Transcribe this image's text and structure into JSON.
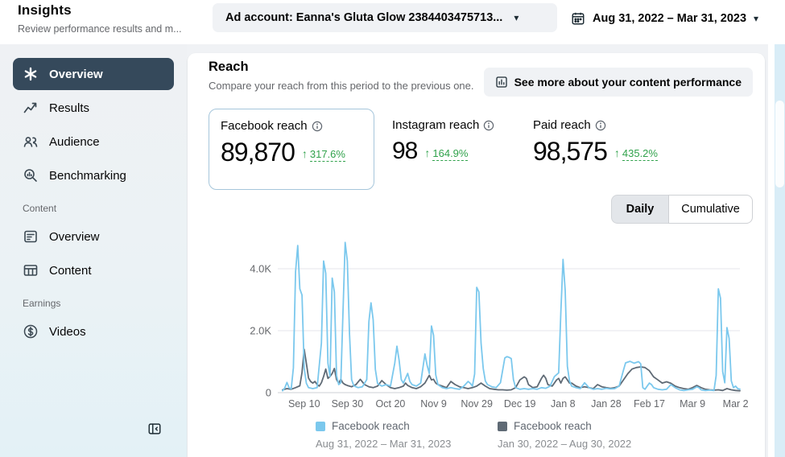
{
  "colors": {
    "positive_green": "#31a24c",
    "nav_active_bg": "#35495b",
    "selected_card_border": "#a6c6db",
    "current_line": "#7bc8ed",
    "previous_line": "#5f6a75"
  },
  "icons": {
    "caret_down": "▾",
    "up_arrow": "↑"
  },
  "header": {
    "title": "Insights",
    "subtitle": "Review performance results and m...",
    "ad_account_label": "Ad account: Eanna's Gluta Glow 2384403475713...",
    "date_range_label": "Aug 31, 2022 – Mar 31, 2023"
  },
  "sidebar": {
    "items": [
      {
        "label": "Overview",
        "active": true
      },
      {
        "label": "Results"
      },
      {
        "label": "Audience"
      },
      {
        "label": "Benchmarking"
      },
      {
        "label": "Overview"
      },
      {
        "label": "Content"
      },
      {
        "label": "Videos"
      }
    ],
    "section_labels": [
      {
        "label": "Content"
      },
      {
        "label": "Earnings"
      }
    ]
  },
  "main": {
    "section_title": "Reach",
    "section_subtitle": "Compare your reach from this period to the previous one.",
    "see_more_button": "See more about your content performance",
    "metrics": [
      {
        "label": "Facebook reach",
        "value": "89,870",
        "delta": "317.6%"
      },
      {
        "label": "Instagram reach",
        "value": "98",
        "delta": "164.9%"
      },
      {
        "label": "Paid reach",
        "value": "98,575",
        "delta": "435.2%"
      }
    ],
    "toggle": {
      "daily": "Daily",
      "cumulative": "Cumulative",
      "selected": "Daily"
    },
    "legend": [
      {
        "label": "Facebook reach",
        "period": "Aug 31, 2022 – Mar 31, 2023"
      },
      {
        "label": "Facebook reach",
        "period": "Jan 30, 2022 – Aug 30, 2022"
      }
    ]
  },
  "chart_data": {
    "type": "line",
    "x_unit": "days since Aug 31, 2022",
    "xlim": [
      0,
      212
    ],
    "ylim": [
      0,
      5000
    ],
    "grid": true,
    "y_ticks": [
      {
        "value": 0,
        "label": "0"
      },
      {
        "value": 2000,
        "label": "2.0K"
      },
      {
        "value": 4000,
        "label": "4.0K"
      }
    ],
    "x_ticks": [
      {
        "day": 10,
        "label": "Sep 10"
      },
      {
        "day": 30,
        "label": "Sep 30"
      },
      {
        "day": 50,
        "label": "Oct 20"
      },
      {
        "day": 70,
        "label": "Nov 9"
      },
      {
        "day": 90,
        "label": "Nov 29"
      },
      {
        "day": 110,
        "label": "Dec 19"
      },
      {
        "day": 130,
        "label": "Jan 8"
      },
      {
        "day": 150,
        "label": "Jan 28"
      },
      {
        "day": 170,
        "label": "Feb 17"
      },
      {
        "day": 190,
        "label": "Mar 9"
      },
      {
        "day": 210,
        "label": "Mar 2"
      }
    ],
    "series": [
      {
        "name": "Facebook reach (Aug 31, 2022 – Mar 31, 2023)",
        "color": "#7bc8ed",
        "points": [
          [
            0,
            60
          ],
          [
            1,
            150
          ],
          [
            2,
            330
          ],
          [
            3,
            160
          ],
          [
            4,
            120
          ],
          [
            5,
            800
          ],
          [
            6,
            3900
          ],
          [
            7,
            4750
          ],
          [
            8,
            3350
          ],
          [
            9,
            3150
          ],
          [
            10,
            800
          ],
          [
            11,
            300
          ],
          [
            12,
            160
          ],
          [
            14,
            130
          ],
          [
            16,
            160
          ],
          [
            18,
            1600
          ],
          [
            19,
            4250
          ],
          [
            20,
            3850
          ],
          [
            21,
            950
          ],
          [
            22,
            520
          ],
          [
            23,
            3700
          ],
          [
            24,
            3250
          ],
          [
            25,
            550
          ],
          [
            26,
            260
          ],
          [
            27,
            320
          ],
          [
            28,
            2600
          ],
          [
            29,
            4850
          ],
          [
            30,
            4250
          ],
          [
            31,
            1900
          ],
          [
            32,
            420
          ],
          [
            33,
            220
          ],
          [
            35,
            160
          ],
          [
            37,
            190
          ],
          [
            39,
            420
          ],
          [
            40,
            2300
          ],
          [
            41,
            2900
          ],
          [
            42,
            2350
          ],
          [
            43,
            750
          ],
          [
            44,
            300
          ],
          [
            46,
            210
          ],
          [
            48,
            260
          ],
          [
            50,
            210
          ],
          [
            52,
            950
          ],
          [
            53,
            1500
          ],
          [
            54,
            1050
          ],
          [
            55,
            420
          ],
          [
            56,
            310
          ],
          [
            58,
            620
          ],
          [
            59,
            360
          ],
          [
            60,
            260
          ],
          [
            62,
            210
          ],
          [
            64,
            310
          ],
          [
            66,
            1250
          ],
          [
            67,
            880
          ],
          [
            68,
            620
          ],
          [
            69,
            2150
          ],
          [
            70,
            1850
          ],
          [
            71,
            580
          ],
          [
            72,
            260
          ],
          [
            74,
            160
          ],
          [
            76,
            130
          ],
          [
            78,
            160
          ],
          [
            80,
            130
          ],
          [
            82,
            110
          ],
          [
            84,
            210
          ],
          [
            86,
            360
          ],
          [
            87,
            300
          ],
          [
            88,
            210
          ],
          [
            89,
            600
          ],
          [
            90,
            3400
          ],
          [
            91,
            3250
          ],
          [
            92,
            1600
          ],
          [
            93,
            780
          ],
          [
            94,
            380
          ],
          [
            95,
            260
          ],
          [
            97,
            190
          ],
          [
            99,
            160
          ],
          [
            101,
            320
          ],
          [
            103,
            1120
          ],
          [
            104,
            1160
          ],
          [
            105,
            1140
          ],
          [
            106,
            1100
          ],
          [
            107,
            420
          ],
          [
            108,
            160
          ],
          [
            110,
            110
          ],
          [
            112,
            130
          ],
          [
            114,
            110
          ],
          [
            116,
            130
          ],
          [
            118,
            110
          ],
          [
            120,
            160
          ],
          [
            122,
            140
          ],
          [
            124,
            210
          ],
          [
            126,
            520
          ],
          [
            128,
            640
          ],
          [
            129,
            2600
          ],
          [
            130,
            4300
          ],
          [
            131,
            3300
          ],
          [
            132,
            850
          ],
          [
            133,
            380
          ],
          [
            134,
            210
          ],
          [
            136,
            160
          ],
          [
            138,
            130
          ],
          [
            140,
            320
          ],
          [
            142,
            160
          ],
          [
            144,
            110
          ],
          [
            146,
            130
          ],
          [
            148,
            110
          ],
          [
            150,
            140
          ],
          [
            152,
            120
          ],
          [
            154,
            130
          ],
          [
            156,
            210
          ],
          [
            158,
            720
          ],
          [
            159,
            960
          ],
          [
            161,
            1010
          ],
          [
            163,
            950
          ],
          [
            165,
            1000
          ],
          [
            166,
            930
          ],
          [
            167,
            160
          ],
          [
            168,
            110
          ],
          [
            170,
            310
          ],
          [
            171,
            260
          ],
          [
            172,
            160
          ],
          [
            174,
            110
          ],
          [
            176,
            90
          ],
          [
            178,
            110
          ],
          [
            180,
            260
          ],
          [
            182,
            160
          ],
          [
            184,
            90
          ],
          [
            186,
            70
          ],
          [
            188,
            90
          ],
          [
            190,
            110
          ],
          [
            192,
            190
          ],
          [
            193,
            160
          ],
          [
            194,
            90
          ],
          [
            196,
            70
          ],
          [
            198,
            80
          ],
          [
            200,
            70
          ],
          [
            201,
            550
          ],
          [
            202,
            3350
          ],
          [
            203,
            3050
          ],
          [
            204,
            680
          ],
          [
            205,
            320
          ],
          [
            206,
            2100
          ],
          [
            207,
            1750
          ],
          [
            208,
            380
          ],
          [
            209,
            160
          ],
          [
            210,
            210
          ],
          [
            211,
            130
          ],
          [
            212,
            110
          ]
        ]
      },
      {
        "name": "Facebook reach (Jan 30, 2022 – Aug 30, 2022)",
        "color": "#5f6a75",
        "points": [
          [
            0,
            90
          ],
          [
            2,
            130
          ],
          [
            4,
            110
          ],
          [
            6,
            160
          ],
          [
            8,
            220
          ],
          [
            9,
            650
          ],
          [
            10,
            1400
          ],
          [
            11,
            950
          ],
          [
            12,
            470
          ],
          [
            13,
            360
          ],
          [
            14,
            310
          ],
          [
            15,
            360
          ],
          [
            16,
            260
          ],
          [
            17,
            210
          ],
          [
            18,
            320
          ],
          [
            19,
            520
          ],
          [
            20,
            760
          ],
          [
            21,
            460
          ],
          [
            22,
            520
          ],
          [
            23,
            620
          ],
          [
            24,
            780
          ],
          [
            25,
            420
          ],
          [
            26,
            310
          ],
          [
            27,
            430
          ],
          [
            28,
            310
          ],
          [
            29,
            260
          ],
          [
            30,
            230
          ],
          [
            32,
            190
          ],
          [
            34,
            260
          ],
          [
            36,
            430
          ],
          [
            38,
            260
          ],
          [
            40,
            190
          ],
          [
            42,
            160
          ],
          [
            44,
            210
          ],
          [
            46,
            390
          ],
          [
            48,
            260
          ],
          [
            50,
            160
          ],
          [
            52,
            130
          ],
          [
            54,
            160
          ],
          [
            56,
            210
          ],
          [
            57,
            310
          ],
          [
            58,
            230
          ],
          [
            60,
            160
          ],
          [
            62,
            130
          ],
          [
            64,
            190
          ],
          [
            66,
            310
          ],
          [
            68,
            560
          ],
          [
            69,
            410
          ],
          [
            70,
            430
          ],
          [
            71,
            310
          ],
          [
            72,
            260
          ],
          [
            74,
            210
          ],
          [
            76,
            160
          ],
          [
            78,
            360
          ],
          [
            80,
            260
          ],
          [
            82,
            190
          ],
          [
            84,
            160
          ],
          [
            86,
            130
          ],
          [
            88,
            160
          ],
          [
            90,
            210
          ],
          [
            92,
            310
          ],
          [
            94,
            210
          ],
          [
            96,
            130
          ],
          [
            98,
            110
          ],
          [
            100,
            90
          ],
          [
            102,
            90
          ],
          [
            104,
            80
          ],
          [
            106,
            90
          ],
          [
            108,
            160
          ],
          [
            110,
            410
          ],
          [
            112,
            510
          ],
          [
            113,
            460
          ],
          [
            114,
            260
          ],
          [
            116,
            160
          ],
          [
            118,
            190
          ],
          [
            120,
            460
          ],
          [
            121,
            560
          ],
          [
            122,
            460
          ],
          [
            123,
            260
          ],
          [
            125,
            210
          ],
          [
            127,
            410
          ],
          [
            128,
            460
          ],
          [
            129,
            310
          ],
          [
            130,
            460
          ],
          [
            131,
            510
          ],
          [
            132,
            410
          ],
          [
            133,
            310
          ],
          [
            134,
            310
          ],
          [
            136,
            210
          ],
          [
            138,
            160
          ],
          [
            140,
            190
          ],
          [
            142,
            160
          ],
          [
            144,
            130
          ],
          [
            146,
            260
          ],
          [
            148,
            190
          ],
          [
            150,
            160
          ],
          [
            152,
            140
          ],
          [
            154,
            160
          ],
          [
            156,
            210
          ],
          [
            158,
            410
          ],
          [
            160,
            610
          ],
          [
            162,
            760
          ],
          [
            164,
            810
          ],
          [
            166,
            830
          ],
          [
            168,
            810
          ],
          [
            170,
            710
          ],
          [
            172,
            510
          ],
          [
            174,
            410
          ],
          [
            176,
            310
          ],
          [
            178,
            350
          ],
          [
            180,
            300
          ],
          [
            182,
            210
          ],
          [
            184,
            160
          ],
          [
            186,
            130
          ],
          [
            188,
            110
          ],
          [
            190,
            160
          ],
          [
            192,
            230
          ],
          [
            194,
            160
          ],
          [
            196,
            110
          ],
          [
            198,
            90
          ],
          [
            200,
            80
          ],
          [
            202,
            90
          ],
          [
            204,
            70
          ],
          [
            206,
            130
          ],
          [
            208,
            90
          ],
          [
            210,
            70
          ],
          [
            212,
            60
          ]
        ]
      }
    ]
  }
}
